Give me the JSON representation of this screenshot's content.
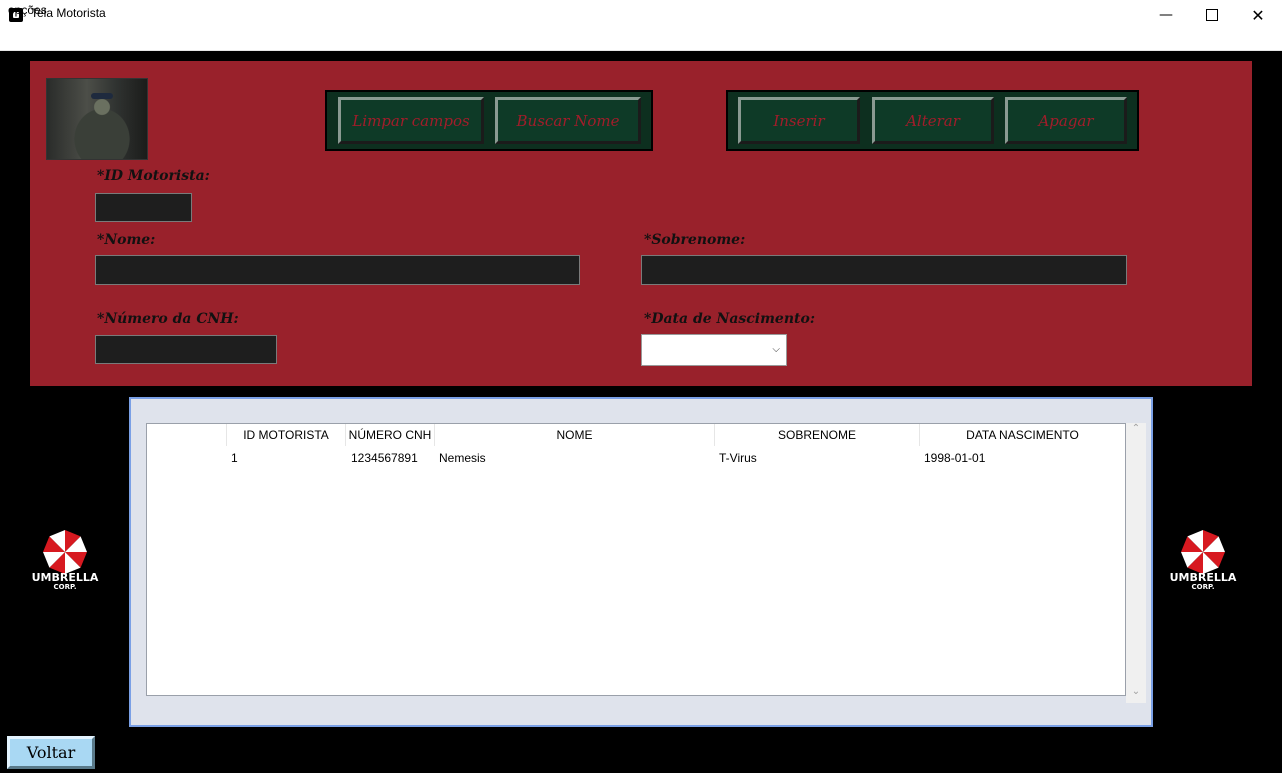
{
  "window": {
    "title": "Tela Motorista"
  },
  "menu": {
    "items": [
      "opções"
    ]
  },
  "buttons": {
    "limpar": "Limpar campos",
    "buscar": "Buscar Nome",
    "inserir": "Inserir",
    "alterar": "Alterar",
    "apagar": "Apagar",
    "voltar": "Voltar"
  },
  "form": {
    "id_label": "*ID Motorista:",
    "nome_label": "*Nome:",
    "sobrenome_label": "*Sobrenome:",
    "cnh_label": "*Número da CNH:",
    "nascimento_label": "*Data de Nascimento:",
    "id_value": "",
    "nome_value": "",
    "sobrenome_value": "",
    "cnh_value": "",
    "nascimento_value": ""
  },
  "table": {
    "columns": [
      "",
      "ID MOTORISTA",
      "NÚMERO CNH",
      "NOME",
      "SOBRENOME",
      "DATA NASCIMENTO"
    ],
    "rows": [
      [
        "",
        "1",
        "1234567891",
        "Nemesis",
        "T-Virus",
        "1998-01-01"
      ]
    ]
  },
  "logos": {
    "brand_top": "UMBRELLA",
    "brand_bottom": "CORP."
  },
  "colors": {
    "panel_red": "#99212b",
    "button_green": "#0e3a27",
    "button_text": "#a11d2a",
    "table_frame": "#7aa0e6",
    "voltar_blue": "#a9d8f3"
  }
}
